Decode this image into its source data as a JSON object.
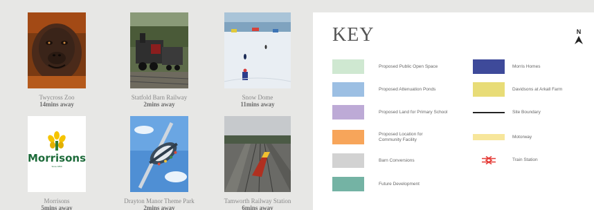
{
  "attractions": [
    {
      "name": "Twycross Zoo",
      "time": "14mins away"
    },
    {
      "name": "Statfold Barn Railway",
      "time": "2mins away"
    },
    {
      "name": "Snow Dome",
      "time": "11mins away"
    },
    {
      "name": "Morrisons",
      "time": "5mins away",
      "logo_text": "Morrisons",
      "logo_sub": "Since 1899"
    },
    {
      "name": "Drayton Manor Theme Park",
      "time": "2mins away"
    },
    {
      "name": "Tamworth Railway Station",
      "time": "6mins away"
    }
  ],
  "key": {
    "title": "KEY",
    "north_label": "N",
    "left": [
      {
        "label": "Proposed Public Open Space",
        "color": "#cfe8d1"
      },
      {
        "label": "Proposed Attenuation Ponds",
        "color": "#9cbfe3"
      },
      {
        "label": "Proposed Land for Primary School",
        "color": "#bdaad6"
      },
      {
        "label": "Proposed Location for Community Facility",
        "color": "#f7a55a"
      },
      {
        "label": "Barn Conversions",
        "color": "#d2d2d2"
      },
      {
        "label": "Future Development",
        "color": "#74b3a4"
      }
    ],
    "right": [
      {
        "label": "Morris Homes",
        "color": "#3e4a9a"
      },
      {
        "label": "Davidsons at Arkall Farm",
        "color": "#e8dc77"
      },
      {
        "label": "Site Boundary",
        "color": "#222222"
      },
      {
        "label": "Motorway",
        "color": "#f7e69b"
      },
      {
        "label": "Train Station",
        "color": "#e53935"
      }
    ]
  }
}
